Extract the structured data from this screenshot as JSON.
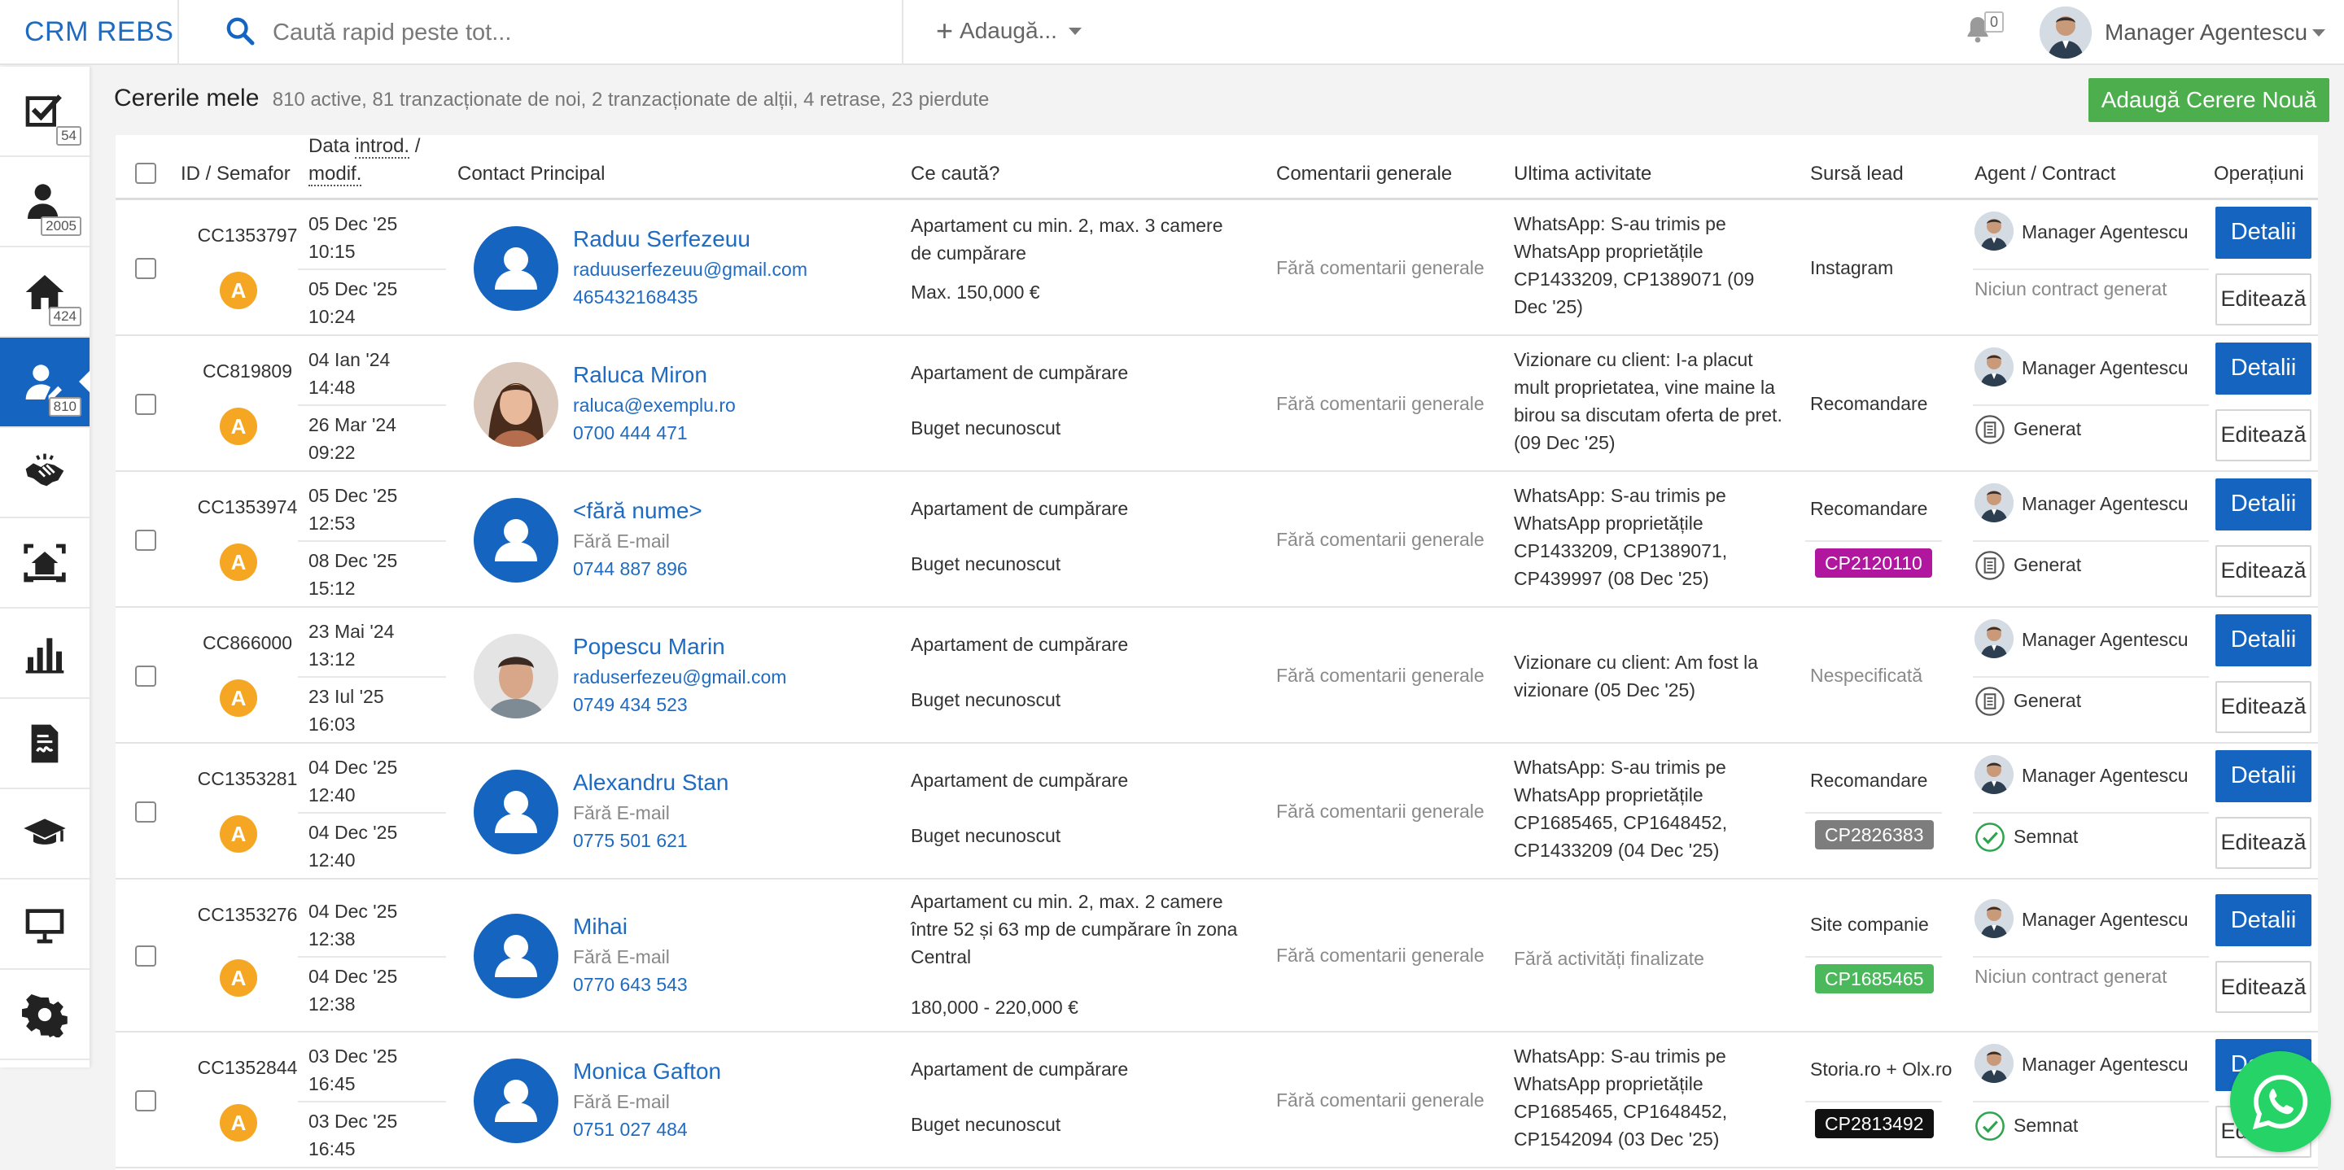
{
  "brand": "CRM REBS",
  "search": {
    "placeholder": "Caută rapid peste tot..."
  },
  "header": {
    "add_label": "Adaugă...",
    "notifications": "0",
    "user_name": "Manager Agentescu"
  },
  "sidebar": {
    "items": [
      {
        "icon": "tasks-icon",
        "badge": "54"
      },
      {
        "icon": "contacts-icon",
        "badge": "2005"
      },
      {
        "icon": "properties-icon",
        "badge": "424"
      },
      {
        "icon": "requests-icon",
        "badge": "810"
      },
      {
        "icon": "handshake-icon",
        "badge": ""
      },
      {
        "icon": "showings-icon",
        "badge": ""
      },
      {
        "icon": "reports-icon",
        "badge": ""
      },
      {
        "icon": "contracts-icon",
        "badge": ""
      },
      {
        "icon": "academy-icon",
        "badge": ""
      },
      {
        "icon": "presentation-icon",
        "badge": ""
      },
      {
        "icon": "settings-icon",
        "badge": ""
      }
    ]
  },
  "page": {
    "title": "Cererile mele",
    "subtitle": "810 active, 81 tranzacționate de noi, 2 tranzacționate de alții, 4 retrase, 23 pierdute",
    "new_button": "Adaugă Cerere Nouă"
  },
  "table": {
    "headers": {
      "id": "ID / Semafor",
      "date_prefix": "Data",
      "date_introd": "introd.",
      "date_slash": " /",
      "date_modif": "modif.",
      "contact": "Contact Principal",
      "seek": "Ce caută?",
      "comments": "Comentarii generale",
      "activity": "Ultima activitate",
      "source": "Sursă lead",
      "agent": "Agent / Contract",
      "ops": "Operațiuni"
    },
    "details_label": "Detalii",
    "edit_label": "Editează",
    "rows": [
      {
        "id": "CC1353797",
        "semafor": "A",
        "date1": "05 Dec '25",
        "time1": "10:15",
        "date2": "05 Dec '25",
        "time2": "10:24",
        "name": "Raduu Serfezeuu",
        "email": "raduuserfezeuu@gmail.com",
        "phone": "465432168435",
        "seek1": "Apartament cu min. 2, max. 3 camere de cumpărare",
        "seek2": "Max. 150,000 €",
        "comments": "Fără comentarii generale",
        "activity": "WhatsApp: S-au trimis pe WhatsApp proprietățile CP1433209, CP1389071 (09 Dec '25)",
        "source": "Instagram",
        "tag": "",
        "agent": "Manager Agentescu",
        "contract": "Niciun contract generat"
      },
      {
        "id": "CC819809",
        "semafor": "A",
        "date1": "04 Ian '24",
        "time1": "14:48",
        "date2": "26 Mar '24",
        "time2": "09:22",
        "name": "Raluca Miron",
        "email": "raluca@exemplu.ro",
        "phone": "0700 444 471",
        "seek1": "Apartament de cumpărare",
        "seek2": "Buget necunoscut",
        "comments": "Fără comentarii generale",
        "activity": "Vizionare cu client: I-a placut mult proprietatea, vine maine la birou sa discutam oferta de pret. (09 Dec '25)",
        "source": "Recomandare",
        "tag": "",
        "agent": "Manager Agentescu",
        "contract": "Generat"
      },
      {
        "id": "CC1353974",
        "semafor": "A",
        "date1": "05 Dec '25",
        "time1": "12:53",
        "date2": "08 Dec '25",
        "time2": "15:12",
        "name": "<fără nume>",
        "email": "Fără E-mail",
        "phone": "0744 887 896",
        "seek1": "Apartament de cumpărare",
        "seek2": "Buget necunoscut",
        "comments": "Fără comentarii generale",
        "activity": "WhatsApp: S-au trimis pe WhatsApp proprietățile CP1433209, CP1389071, CP439997 (08 Dec '25)",
        "source": "Recomandare",
        "tag": "CP2120110",
        "agent": "Manager Agentescu",
        "contract": "Generat"
      },
      {
        "id": "CC866000",
        "semafor": "A",
        "date1": "23 Mai '24",
        "time1": "13:12",
        "date2": "23 Iul '25",
        "time2": "16:03",
        "name": "Popescu Marin",
        "email": "raduserfezeu@gmail.com",
        "phone": "0749 434 523",
        "seek1": "Apartament de cumpărare",
        "seek2": "Buget necunoscut",
        "comments": "Fără comentarii generale",
        "activity": "Vizionare cu client: Am fost la vizionare (05 Dec '25)",
        "source": "Nespecificată",
        "tag": "",
        "agent": "Manager Agentescu",
        "contract": "Generat"
      },
      {
        "id": "CC1353281",
        "semafor": "A",
        "date1": "04 Dec '25",
        "time1": "12:40",
        "date2": "04 Dec '25",
        "time2": "12:40",
        "name": "Alexandru Stan",
        "email": "Fără E-mail",
        "phone": "0775 501 621",
        "seek1": "Apartament de cumpărare",
        "seek2": "Buget necunoscut",
        "comments": "Fără comentarii generale",
        "activity": "WhatsApp: S-au trimis pe WhatsApp proprietățile CP1685465, CP1648452, CP1433209 (04 Dec '25)",
        "source": "Recomandare",
        "tag": "CP2826383",
        "agent": "Manager Agentescu",
        "contract": "Semnat"
      },
      {
        "id": "CC1353276",
        "semafor": "A",
        "date1": "04 Dec '25",
        "time1": "12:38",
        "date2": "04 Dec '25",
        "time2": "12:38",
        "name": "Mihai",
        "email": "Fără E-mail",
        "phone": "0770 643 543",
        "seek1": "Apartament cu min. 2, max. 2 camere între 52 și 63 mp de cumpărare în zona Central",
        "seek2": "180,000 - 220,000 €",
        "comments": "Fără comentarii generale",
        "activity": "Fără activități finalizate",
        "source": "Site companie",
        "tag": "CP1685465",
        "agent": "Manager Agentescu",
        "contract": "Niciun contract generat"
      },
      {
        "id": "CC1352844",
        "semafor": "A",
        "date1": "03 Dec '25",
        "time1": "16:45",
        "date2": "03 Dec '25",
        "time2": "16:45",
        "name": "Monica Gafton",
        "email": "Fără E-mail",
        "phone": "0751 027 484",
        "seek1": "Apartament de cumpărare",
        "seek2": "Buget necunoscut",
        "comments": "Fără comentarii generale",
        "activity": "WhatsApp: S-au trimis pe WhatsApp proprietățile CP1685465, CP1648452, CP1542094 (03 Dec '25)",
        "source": "Storia.ro + Olx.ro",
        "tag": "CP2813492",
        "agent": "Manager Agentescu",
        "contract": "Semnat"
      }
    ]
  },
  "colors": {
    "brand_blue": "#1565c0",
    "link_blue": "#1f6bc1",
    "green": "#4cae4c",
    "semafor_orange": "#f5a623",
    "tag_purple": "#b0169e",
    "tag_gray": "#7d7d7d",
    "tag_green": "#4cb85c",
    "tag_black": "#111111",
    "whatsapp": "#25d366"
  }
}
